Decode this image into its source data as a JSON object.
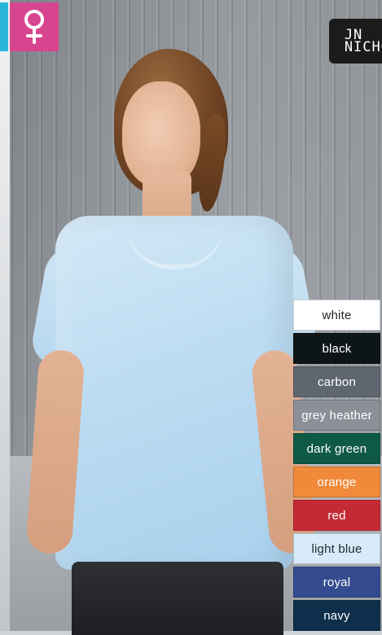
{
  "badge": {
    "icon": "female-icon",
    "color": "#d8458f",
    "side_tab_color": "#28b5d9"
  },
  "logo": {
    "text": "JN\nNICHO",
    "bg": "#1b1b1b"
  },
  "swatches": [
    {
      "label": "white",
      "bg": "#ffffff",
      "fg": "#222222"
    },
    {
      "label": "black",
      "bg": "#0e1517",
      "fg": "#ffffff"
    },
    {
      "label": "carbon",
      "bg": "#5e6670",
      "fg": "#ffffff"
    },
    {
      "label": "grey heather",
      "bg": "#8c8f97",
      "fg": "#ffffff"
    },
    {
      "label": "dark green",
      "bg": "#0f5a45",
      "fg": "#ffffff"
    },
    {
      "label": "orange",
      "bg": "#f08a3a",
      "fg": "#ffffff"
    },
    {
      "label": "red",
      "bg": "#c42a34",
      "fg": "#ffffff"
    },
    {
      "label": "light blue",
      "bg": "#d7ebf9",
      "fg": "#1f2a33"
    },
    {
      "label": "royal",
      "bg": "#344b8f",
      "fg": "#ffffff"
    },
    {
      "label": "navy",
      "bg": "#0e2f4b",
      "fg": "#ffffff"
    }
  ]
}
